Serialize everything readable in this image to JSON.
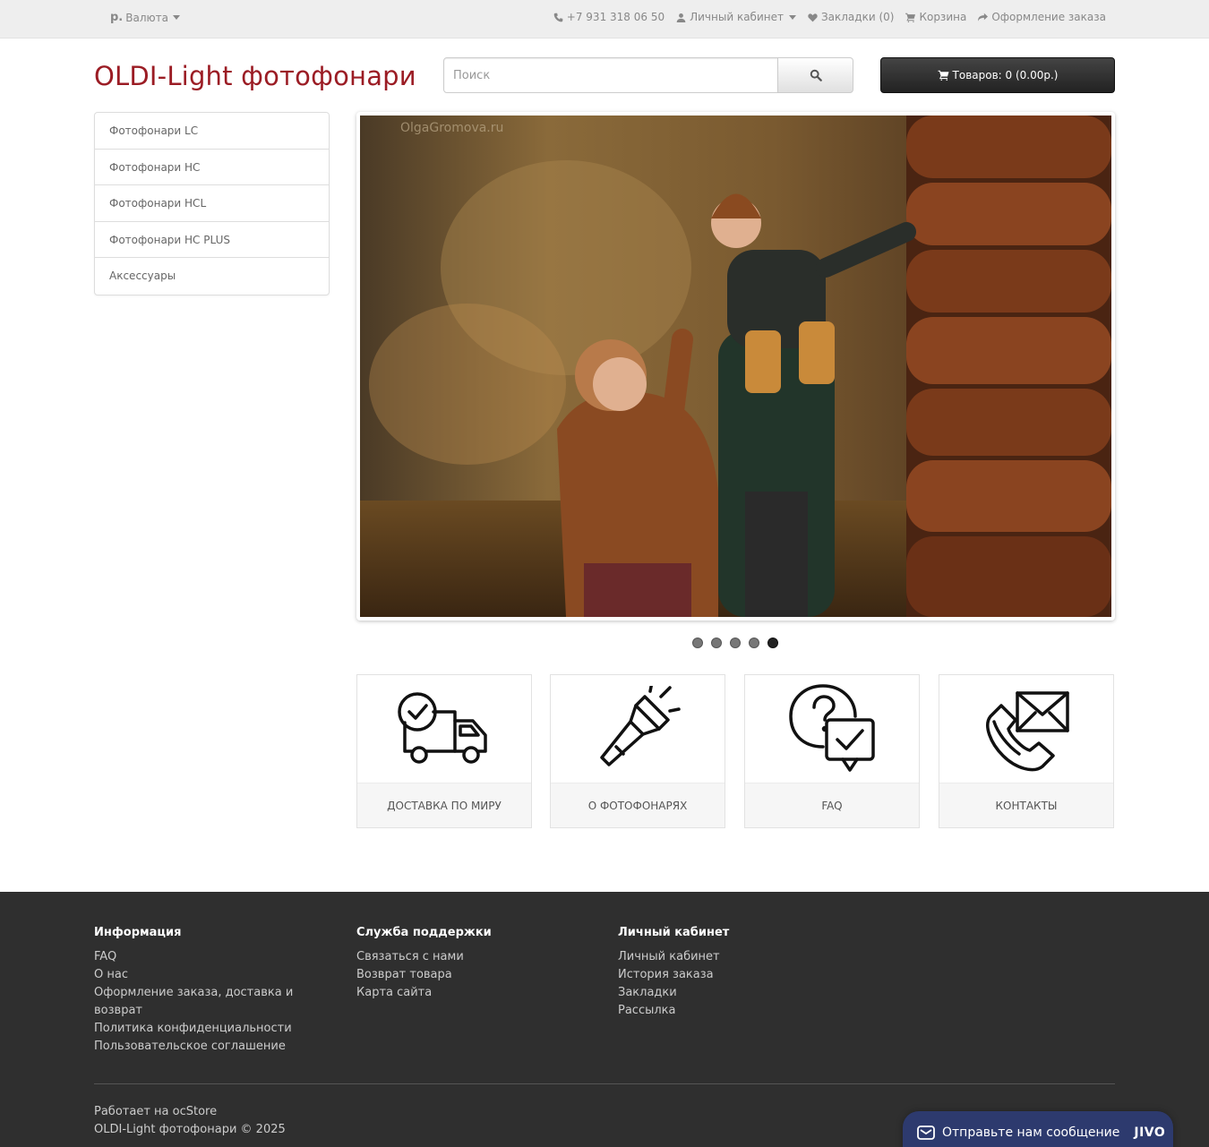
{
  "topbar": {
    "currency_symbol": "р.",
    "currency_label": "Валюта",
    "phone": "+7 931 318 06 50",
    "account": "Личный кабинет",
    "wishlist": "Закладки (0)",
    "cart": "Корзина",
    "checkout": "Оформление заказа"
  },
  "header": {
    "logo": "OLDI-Light фотофонари",
    "search_placeholder": "Поиск",
    "cart_button": "Товаров: 0 (0.00р.)"
  },
  "sidebar": {
    "items": [
      {
        "label": "Фотофонари LC"
      },
      {
        "label": "Фотофонари HC"
      },
      {
        "label": "Фотофонари HCL"
      },
      {
        "label": "Фотофонари HC PLUS"
      },
      {
        "label": "Аксессуары"
      }
    ]
  },
  "slideshow": {
    "watermark": "OlgaGromova.ru",
    "slide_count": 5,
    "active_index": 5
  },
  "tiles": [
    {
      "label": "ДОСТАВКА ПО МИРУ",
      "icon": "delivery-truck-icon"
    },
    {
      "label": "О ФОТОФОНАРЯХ",
      "icon": "flashlight-icon"
    },
    {
      "label": "FAQ",
      "icon": "faq-chat-icon"
    },
    {
      "label": "КОНТАКТЫ",
      "icon": "contact-phone-mail-icon"
    }
  ],
  "footer": {
    "info_title": "Информация",
    "info_links": [
      "FAQ",
      "О нас",
      "Оформление заказа, доставка и возврат",
      "Политика конфиденциальности",
      "Пользовательское соглашение"
    ],
    "support_title": "Служба поддержки",
    "support_links": [
      "Связаться с нами",
      "Возврат товара",
      "Карта сайта"
    ],
    "account_title": "Личный кабинет",
    "account_links": [
      "Личный кабинет",
      "История заказа",
      "Закладки",
      "Рассылка"
    ],
    "powered_prefix": "Работает на",
    "powered_link": "ocStore",
    "copyright": "OLDI-Light фотофонари © 2025"
  },
  "chat_widget": {
    "label": "Отправьте нам сообщение",
    "brand": "JIVO"
  },
  "colors": {
    "brand": "#9b1c24",
    "footer_bg": "#2f2f2f",
    "jivo_bg": "#2d3a6e"
  }
}
